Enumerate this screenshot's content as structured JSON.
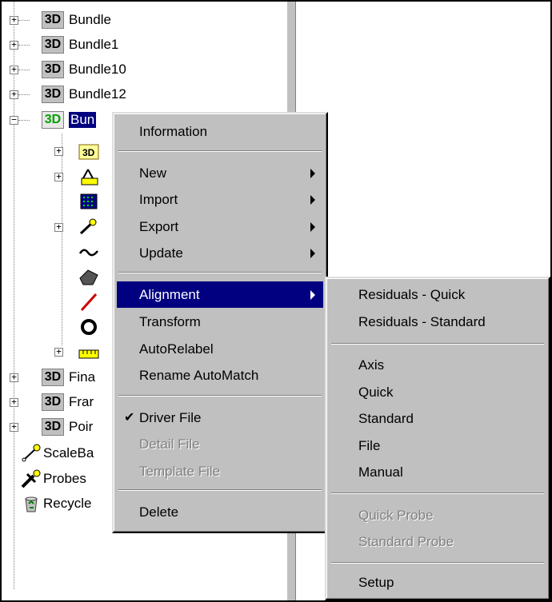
{
  "tree": {
    "items": [
      {
        "badge": "3D",
        "label": "Bundle"
      },
      {
        "badge": "3D",
        "label": "Bundle1"
      },
      {
        "badge": "3D",
        "label": "Bundle10"
      },
      {
        "badge": "3D",
        "label": "Bundle12"
      },
      {
        "badge": "3D",
        "label": "Bun"
      },
      {
        "badge": "3D",
        "label": "Fina"
      },
      {
        "badge": "3D",
        "label": "Frar"
      },
      {
        "badge": "3D",
        "label": "Poir"
      },
      {
        "label": "ScaleBa"
      },
      {
        "label": "Probes"
      },
      {
        "label": "Recycle"
      }
    ],
    "expanded_symbol": "−",
    "collapsed_symbol": "+"
  },
  "context_menu": {
    "information": "Information",
    "new": "New",
    "import": "Import",
    "export": "Export",
    "update": "Update",
    "alignment": "Alignment",
    "transform": "Transform",
    "autorelabel": "AutoRelabel",
    "rename_automatch": "Rename AutoMatch",
    "driver_file": "Driver File",
    "driver_file_check": "✔",
    "detail_file": "Detail File",
    "template_file": "Template File",
    "delete": "Delete"
  },
  "submenu": {
    "residuals_quick": "Residuals - Quick",
    "residuals_standard": "Residuals - Standard",
    "axis": "Axis",
    "quick": "Quick",
    "standard": "Standard",
    "file": "File",
    "manual": "Manual",
    "quick_probe": "Quick Probe",
    "standard_probe": "Standard Probe",
    "setup": "Setup"
  },
  "colors": {
    "menu_bg": "#c0c0c0",
    "highlight": "#000080",
    "disabled": "#808080"
  }
}
